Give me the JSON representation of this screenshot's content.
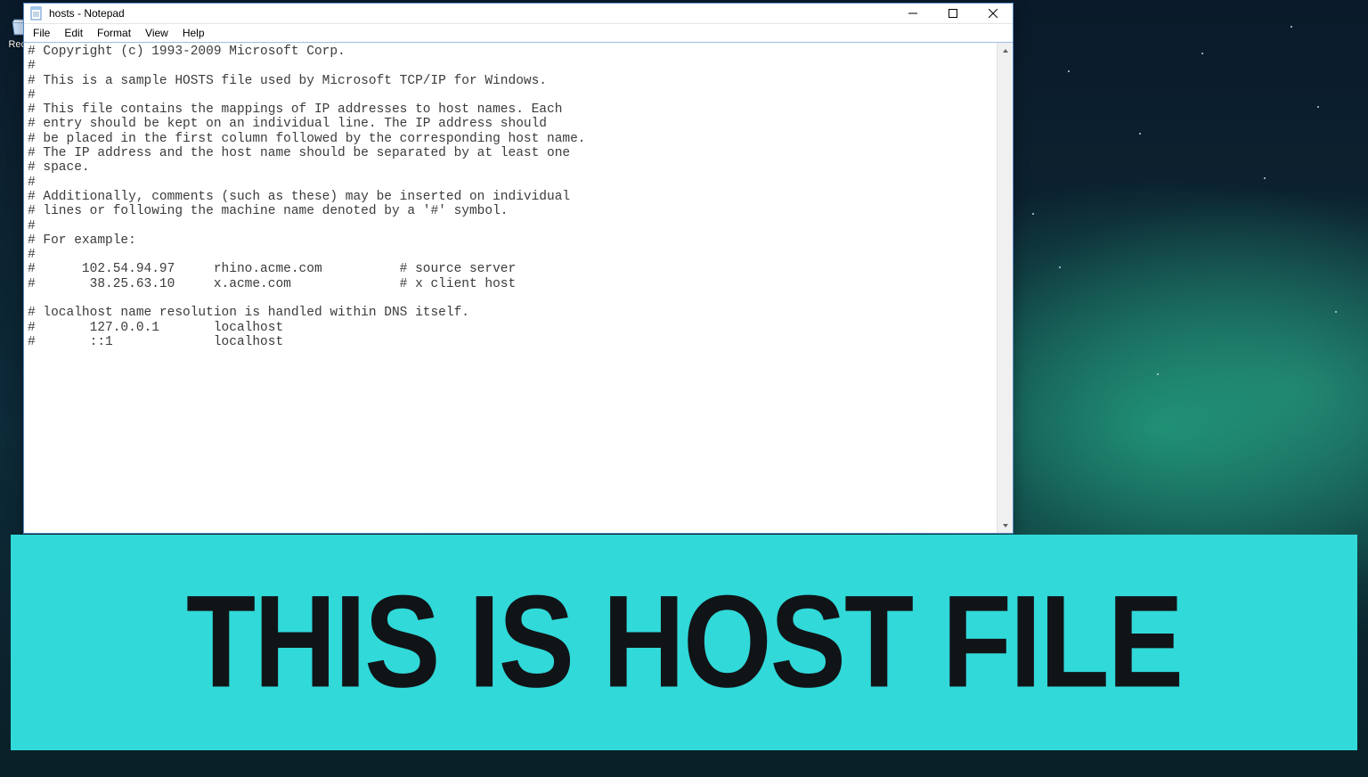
{
  "desktop": {
    "recycle_label": "Recy"
  },
  "window": {
    "title": "hosts - Notepad"
  },
  "menu": {
    "file": "File",
    "edit": "Edit",
    "format": "Format",
    "view": "View",
    "help": "Help"
  },
  "document": {
    "content": "# Copyright (c) 1993-2009 Microsoft Corp.\n#\n# This is a sample HOSTS file used by Microsoft TCP/IP for Windows.\n#\n# This file contains the mappings of IP addresses to host names. Each\n# entry should be kept on an individual line. The IP address should\n# be placed in the first column followed by the corresponding host name.\n# The IP address and the host name should be separated by at least one\n# space.\n#\n# Additionally, comments (such as these) may be inserted on individual\n# lines or following the machine name denoted by a '#' symbol.\n#\n# For example:\n#\n#      102.54.94.97     rhino.acme.com          # source server\n#       38.25.63.10     x.acme.com              # x client host\n\n# localhost name resolution is handled within DNS itself.\n#       127.0.0.1       localhost\n#       ::1             localhost"
  },
  "banner": {
    "text": "THIS IS HOST FILE"
  }
}
